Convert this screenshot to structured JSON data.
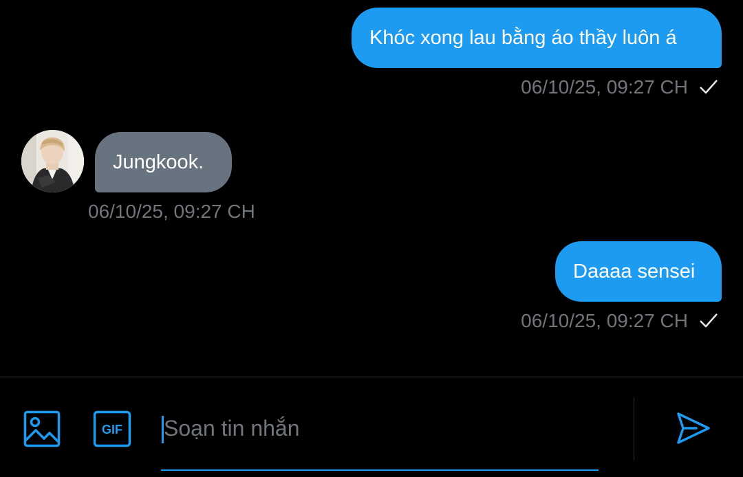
{
  "messages": [
    {
      "direction": "sent",
      "text": "Khóc xong lau bằng áo thầy luôn á",
      "timestamp": "06/10/25, 09:27 CH",
      "status_icon": "check-icon"
    },
    {
      "direction": "received",
      "text": "Jungkook.",
      "timestamp": "06/10/25, 09:27 CH",
      "avatar_icon": "avatar"
    },
    {
      "direction": "sent",
      "text": "Daaaa sensei",
      "timestamp": "06/10/25, 09:27 CH",
      "status_icon": "check-icon"
    }
  ],
  "composer": {
    "placeholder": "Soạn tin nhắn",
    "value": "",
    "icons": [
      "image-icon",
      "gif-icon",
      "send-icon"
    ],
    "gif_label": "GIF"
  },
  "colors": {
    "accent": "#1d9bf0",
    "received_bubble": "#67737f",
    "meta_text": "#71767b",
    "background": "#000000"
  }
}
